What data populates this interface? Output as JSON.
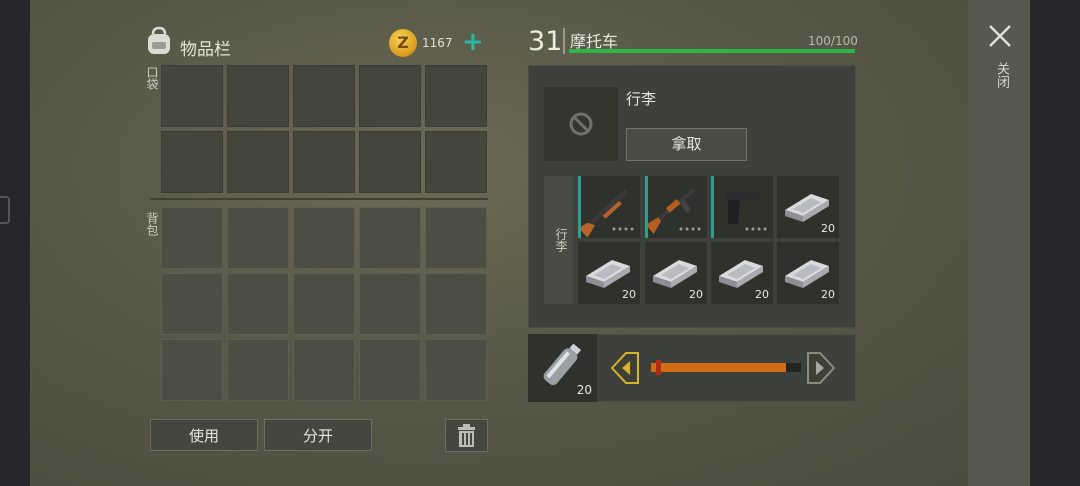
{
  "inventory": {
    "title": "物品栏",
    "coins": "1167",
    "coin_symbol": "Z",
    "add": "+",
    "pocket_label": "口袋",
    "backpack_label": "背包",
    "use_label": "使用",
    "split_label": "分开"
  },
  "vehicle": {
    "level": "31",
    "name": "摩托车",
    "health": "100/100",
    "health_fraction": 1.0,
    "section_title": "行李",
    "take_label": "拿取",
    "luggage_label": "行李",
    "items": [
      {
        "icon": "shotgun-icon",
        "qty": ""
      },
      {
        "icon": "ak-rifle-icon",
        "qty": ""
      },
      {
        "icon": "pistol-icon",
        "qty": ""
      },
      {
        "icon": "iron-bar-icon",
        "qty": "20"
      },
      {
        "icon": "iron-bar-icon",
        "qty": "20"
      },
      {
        "icon": "iron-bar-icon",
        "qty": "20"
      },
      {
        "icon": "iron-bar-icon",
        "qty": "20"
      },
      {
        "icon": "iron-bar-icon",
        "qty": "20"
      }
    ]
  },
  "fuel": {
    "icon": "fuel-bottle-icon",
    "qty": "20",
    "level_fraction": 0.9
  },
  "close_label": "关闭",
  "colors": {
    "accent": "#2bb7a4",
    "health": "#2fb448",
    "fuel": "#d26c16",
    "arrow_active": "#d6b12a"
  }
}
